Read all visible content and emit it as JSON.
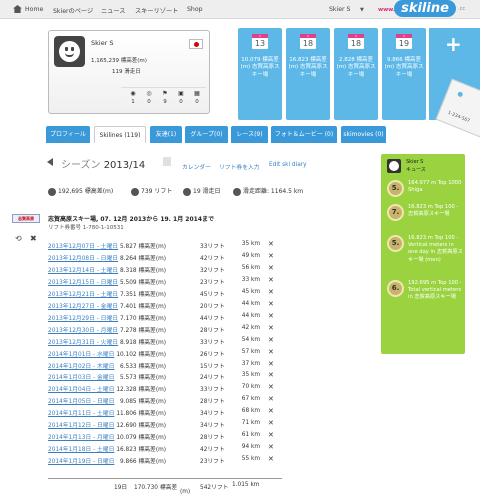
{
  "nav": {
    "home": "Home",
    "mypage": "Skierのページ",
    "news": "ニュース",
    "resorts": "スキーリゾート",
    "shop": "Shop",
    "user": "Skier S",
    "logo_www": "www.",
    "logo_main": "skiline",
    "logo_cc": ".cc"
  },
  "profile": {
    "name": "Skier S",
    "vertical": "1,165,239 標高差(m)",
    "days": "119 滑走日",
    "counters": [
      "1",
      "0",
      "9",
      "0",
      "0"
    ]
  },
  "cards": [
    {
      "month": "1",
      "day": "13",
      "text": "10.079 標高差(m) 志賀高原スキー場"
    },
    {
      "month": "1",
      "day": "18",
      "text": "16.823 標高差(m) 志賀高原スキー場"
    },
    {
      "month": "1",
      "day": "18",
      "text": "2.828 標高差(m) 志賀高原スキー場"
    },
    {
      "month": "1",
      "day": "19",
      "text": "9.866 標高差(m) 志賀高原スキー場"
    }
  ],
  "ticket_number": "1-234-567",
  "tabs": [
    "プロフィール",
    "Skilines (119)",
    "友達(1)",
    "グループ(0)",
    "レース(9)",
    "フォト＆ムービー (0)",
    "skimovies (0)"
  ],
  "season": {
    "label": "シーズン",
    "year": "2013/14",
    "calendar": "カレンダー",
    "add_ticket": "リフト券を入力",
    "edit_diary": "Edit ski diary"
  },
  "stats": {
    "vertical": "192,695 標高差(m)",
    "lifts": "739 リフト",
    "days": "19 滑走日",
    "distance": "滑走距離: 1164.5 km"
  },
  "resort": {
    "logo": "志賀高原",
    "title": "志賀高原スキー場, 07. 12月 2013から 19. 1月 2014まで",
    "ticket": "リフト券番号 1-780-1-10531"
  },
  "rows": [
    {
      "date": "2013年12月07日 - 土曜日",
      "vert": "5.827 標高差(m)",
      "lifts": "33リフト",
      "dist": "35 km"
    },
    {
      "date": "2013年12月08日 - 日曜日",
      "vert": "8.264 標高差(m)",
      "lifts": "42リフト",
      "dist": "49 km"
    },
    {
      "date": "2013年12月14日 - 土曜日",
      "vert": "8.318 標高差(m)",
      "lifts": "32リフト",
      "dist": "56 km"
    },
    {
      "date": "2013年12月15日 - 日曜日",
      "vert": "5.509 標高差(m)",
      "lifts": "23リフト",
      "dist": "33 km"
    },
    {
      "date": "2013年12月21日 - 土曜日",
      "vert": "7.351 標高差(m)",
      "lifts": "45リフト",
      "dist": "45 km"
    },
    {
      "date": "2013年12月27日 - 金曜日",
      "vert": "7.401 標高差(m)",
      "lifts": "20リフト",
      "dist": "44 km"
    },
    {
      "date": "2013年12月29日 - 日曜日",
      "vert": "7.170 標高差(m)",
      "lifts": "44リフト",
      "dist": "44 km"
    },
    {
      "date": "2013年12月30日 - 月曜日",
      "vert": "7.278 標高差(m)",
      "lifts": "28リフト",
      "dist": "42 km"
    },
    {
      "date": "2013年12月31日 - 火曜日",
      "vert": "8.918 標高差(m)",
      "lifts": "33リフト",
      "dist": "54 km"
    },
    {
      "date": "2014年1月01日 - 水曜日",
      "vert": "10.102 標高差(m)",
      "lifts": "26リフト",
      "dist": "57 km"
    },
    {
      "date": "2014年1月02日 - 木曜日",
      "vert": "6.533 標高差(m)",
      "lifts": "15リフト",
      "dist": "37 km"
    },
    {
      "date": "2014年1月03日 - 金曜日",
      "vert": "5.573 標高差(m)",
      "lifts": "24リフト",
      "dist": "35 km"
    },
    {
      "date": "2014年1月04日 - 土曜日",
      "vert": "12.328 標高差(m)",
      "lifts": "33リフト",
      "dist": "70 km"
    },
    {
      "date": "2014年1月05日 - 日曜日",
      "vert": "9.085 標高差(m)",
      "lifts": "28リフト",
      "dist": "67 km"
    },
    {
      "date": "2014年1月11日 - 土曜日",
      "vert": "11.806 標高差(m)",
      "lifts": "34リフト",
      "dist": "68 km"
    },
    {
      "date": "2014年1月12日 - 日曜日",
      "vert": "12.690 標高差(m)",
      "lifts": "34リフト",
      "dist": "71 km"
    },
    {
      "date": "2014年1月13日 - 月曜日",
      "vert": "10.079 標高差(m)",
      "lifts": "28リフト",
      "dist": "61 km"
    },
    {
      "date": "2014年1月18日 - 土曜日",
      "vert": "16.823 標高差(m)",
      "lifts": "42リフト",
      "dist": "94 km"
    },
    {
      "date": "2014年1月19日 - 日曜日",
      "vert": "9.866 標高差(m)",
      "lifts": "23リフト",
      "dist": "55 km"
    }
  ],
  "total": {
    "days": "19日",
    "vert": "170.730 標高差",
    "unit": "(m)",
    "lifts": "542リフト",
    "dist": "1.015 km"
  },
  "panel": {
    "name": "Skier S",
    "sub": "キュース",
    "ranks": [
      {
        "rank": "5.",
        "text": "164.977 m Top 1000 Shiga"
      },
      {
        "rank": "7.",
        "text": "16.823 m Top 100 - 志賀高原スキー場"
      },
      {
        "rank": "5.",
        "text": "16.823 m Top 100 - Vertical meters in one day in 志賀高原スキー場 (men)"
      },
      {
        "rank": "6.",
        "text": "192.695 m Top 100 - Total vertical meters in 志賀高原スキー場"
      }
    ]
  },
  "colors": {
    "accent": "#3a9ad9",
    "card": "#5db8e8",
    "panel": "#9ad33f",
    "link": "#3a7fc1"
  }
}
